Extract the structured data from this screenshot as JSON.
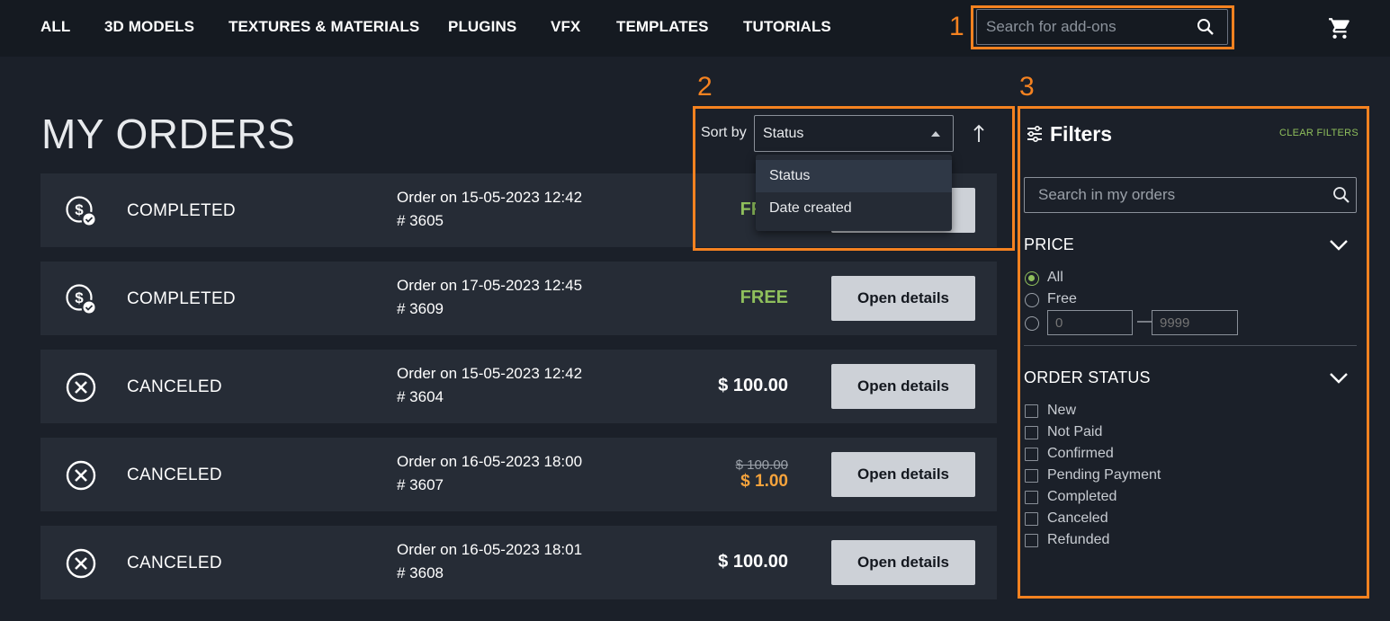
{
  "nav": {
    "items": [
      "ALL",
      "3D MODELS",
      "TEXTURES & MATERIALS",
      "PLUGINS",
      "VFX",
      "TEMPLATES",
      "TUTORIALS"
    ],
    "search_placeholder": "Search for add-ons",
    "cart_icon": "cart-icon"
  },
  "annotations": [
    "1",
    "2",
    "3"
  ],
  "annotation_color": "#f58220",
  "page": {
    "title": "MY ORDERS"
  },
  "sort": {
    "label": "Sort by",
    "selected": "Status",
    "options": [
      "Status",
      "Date created"
    ],
    "direction_icon": "arrow-up-icon"
  },
  "orders": [
    {
      "status": "COMPLETED",
      "status_icon": "dollar-check-icon",
      "date": "Order on 15-05-2023 12:42",
      "number": "# 3605",
      "price": "FREE",
      "price_type": "free",
      "button": "Open details"
    },
    {
      "status": "COMPLETED",
      "status_icon": "dollar-check-icon",
      "date": "Order on 17-05-2023 12:45",
      "number": "# 3609",
      "price": "FREE",
      "price_type": "free",
      "button": "Open details"
    },
    {
      "status": "CANCELED",
      "status_icon": "cancel-circle-icon",
      "date": "Order on 15-05-2023 12:42",
      "number": "# 3604",
      "price": "$ 100.00",
      "price_type": "paid",
      "button": "Open details"
    },
    {
      "status": "CANCELED",
      "status_icon": "cancel-circle-icon",
      "date": "Order on 16-05-2023 18:00",
      "number": "# 3607",
      "price_old": "$ 100.00",
      "price": "$ 1.00",
      "price_type": "discount",
      "button": "Open details"
    },
    {
      "status": "CANCELED",
      "status_icon": "cancel-circle-icon",
      "date": "Order on 16-05-2023 18:01",
      "number": "# 3608",
      "price": "$ 100.00",
      "price_type": "paid",
      "button": "Open details"
    }
  ],
  "filters": {
    "title": "Filters",
    "clear_label": "CLEAR FILTERS",
    "search_placeholder": "Search in my orders",
    "price": {
      "title": "PRICE",
      "options": [
        "All",
        "Free"
      ],
      "selected": "All",
      "min_placeholder": "0",
      "max_placeholder": "9999"
    },
    "order_status": {
      "title": "ORDER STATUS",
      "options": [
        "New",
        "Not Paid",
        "Confirmed",
        "Pending Payment",
        "Completed",
        "Canceled",
        "Refunded"
      ]
    }
  },
  "colors": {
    "accent_green": "#8fbf5c",
    "discount_orange": "#f5a33c",
    "background": "#1b2029",
    "row": "#262c36"
  }
}
